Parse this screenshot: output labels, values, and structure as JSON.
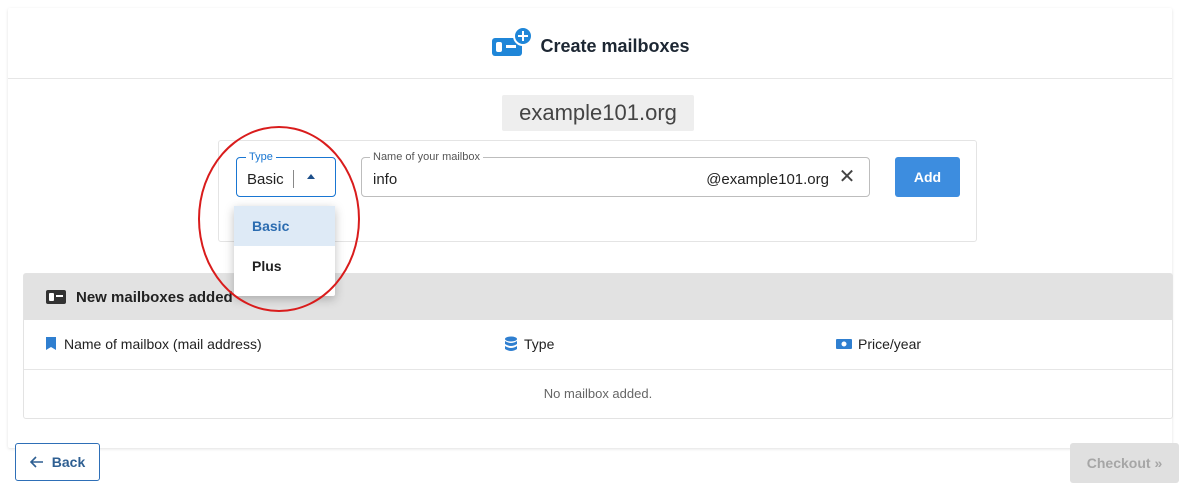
{
  "header": {
    "title": "Create mailboxes"
  },
  "domain": "example101.org",
  "form": {
    "type_label": "Type",
    "type_value": "Basic",
    "type_options": [
      "Basic",
      "Plus"
    ],
    "type_selected": "Basic",
    "name_label": "Name of your mailbox",
    "name_value": "info",
    "name_suffix": "@example101.org",
    "add_label": "Add"
  },
  "table": {
    "title": "New mailboxes added",
    "columns": [
      "Name of mailbox (mail address)",
      "Type",
      "Price/year"
    ],
    "empty_text": "No mailbox added."
  },
  "footer": {
    "back_label": "Back",
    "checkout_label": "Checkout »"
  },
  "colors": {
    "accent": "#3d8ddf",
    "highlight": "#d91c1c"
  }
}
